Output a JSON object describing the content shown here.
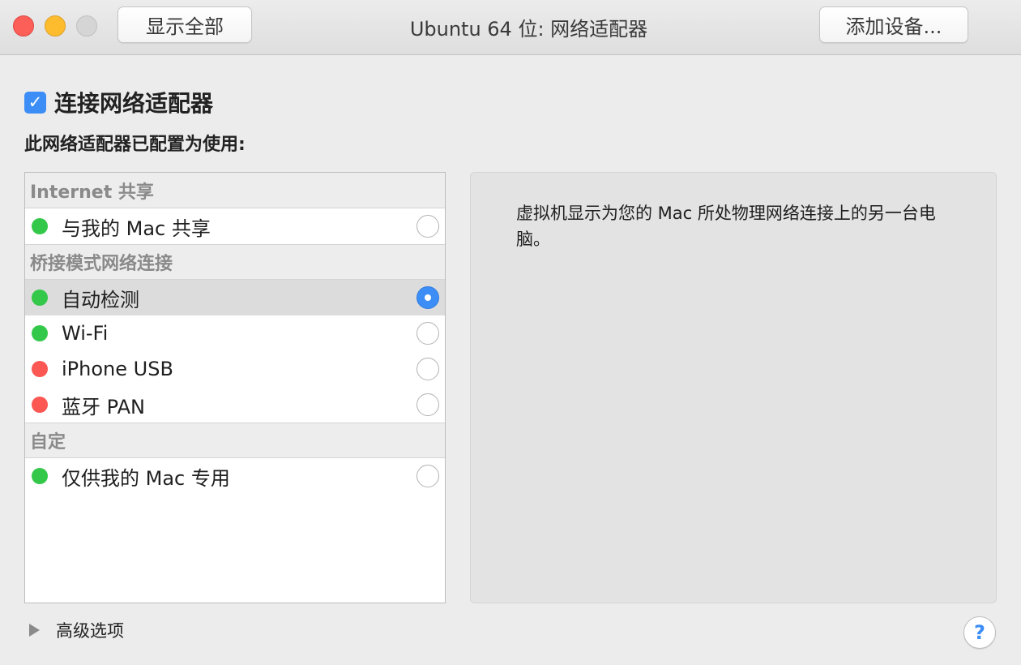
{
  "titlebar": {
    "show_all_label": "显示全部",
    "title": "Ubuntu 64 位: 网络适配器",
    "add_device_label": "添加设备..."
  },
  "connect": {
    "checked": true,
    "check_glyph": "✓",
    "label": "连接网络适配器"
  },
  "config_label": "此网络适配器已配置为使用:",
  "groups": [
    {
      "header": "Internet 共享",
      "items": [
        {
          "label": "与我的 Mac 共享",
          "status": "green",
          "selected": false
        }
      ]
    },
    {
      "header": "桥接模式网络连接",
      "items": [
        {
          "label": "自动检测",
          "status": "green",
          "selected": true
        },
        {
          "label": "Wi-Fi",
          "status": "green",
          "selected": false
        },
        {
          "label": "iPhone USB",
          "status": "red",
          "selected": false
        },
        {
          "label": "蓝牙 PAN",
          "status": "red",
          "selected": false
        }
      ]
    },
    {
      "header": "自定",
      "items": [
        {
          "label": "仅供我的 Mac 专用",
          "status": "green",
          "selected": false
        }
      ]
    }
  ],
  "description": "虚拟机显示为您的 Mac 所处物理网络连接上的另一台电脑。",
  "advanced_label": "高级选项",
  "help_glyph": "?",
  "colors": {
    "accent": "#3c8ef6",
    "status_green": "#34c84a",
    "status_red": "#fc5753"
  }
}
